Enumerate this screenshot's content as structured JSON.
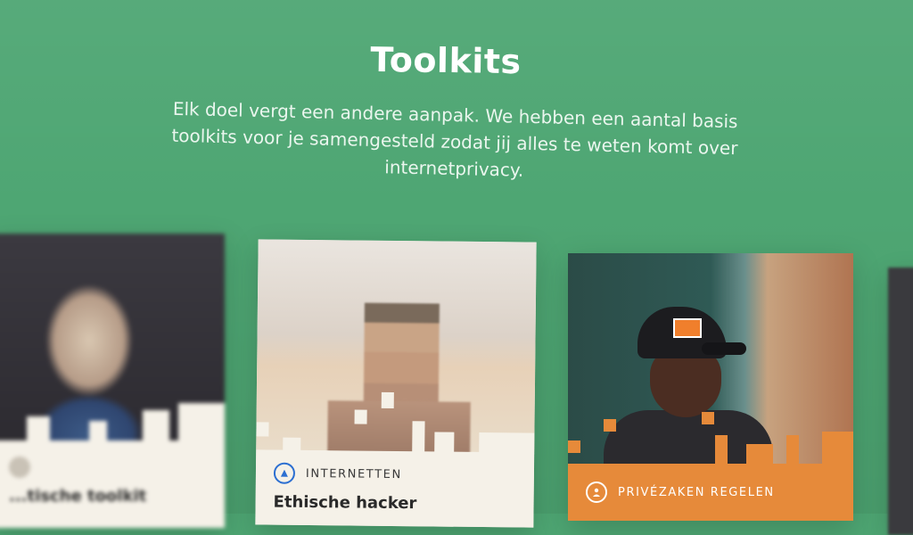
{
  "page": {
    "title": "Toolkits",
    "intro": "Elk doel vergt een andere aanpak. We hebben een aantal basis toolkits voor je samengesteld zodat jij alles te weten komt over internetprivacy."
  },
  "cards": [
    {
      "tag": "",
      "title": "...tische toolkit",
      "icon": "person-icon"
    },
    {
      "tag": "INTERNETTEN",
      "title": "Ethische hacker",
      "icon": "compass-icon",
      "tag_color": "#2c6fd1"
    },
    {
      "tag": "PRIVÉZAKEN REGELEN",
      "title": "",
      "icon": "user-icon",
      "tag_color": "#fff"
    }
  ],
  "colors": {
    "background": "#4ea673",
    "card_bg": "#f5f1e8",
    "orange": "#e68a3a"
  }
}
